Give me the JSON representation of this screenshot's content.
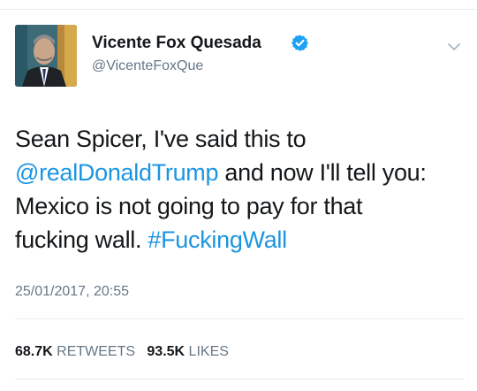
{
  "user": {
    "display_name": "Vicente Fox Quesada",
    "handle": "@VicenteFoxQue",
    "verified": true
  },
  "tweet": {
    "line1": "Sean Spicer, I've said this to",
    "mention": "@realDonaldTrump",
    "line2_rest": " and now I'll tell you:",
    "line3": "Mexico is not going to pay for that",
    "line4_text": "fucking wall. ",
    "hashtag": "#FuckingWall"
  },
  "timestamp": "25/01/2017, 20:55",
  "stats": {
    "retweets_count": "68.7K",
    "retweets_label": "RETWEETS",
    "likes_count": "93.5K",
    "likes_label": "LIKES"
  },
  "colors": {
    "link": "#1b95e0",
    "secondary_text": "#657786",
    "verified_badge": "#1da1f2"
  },
  "icons": {
    "verified": "verified-badge-icon",
    "menu": "chevron-down-icon"
  }
}
